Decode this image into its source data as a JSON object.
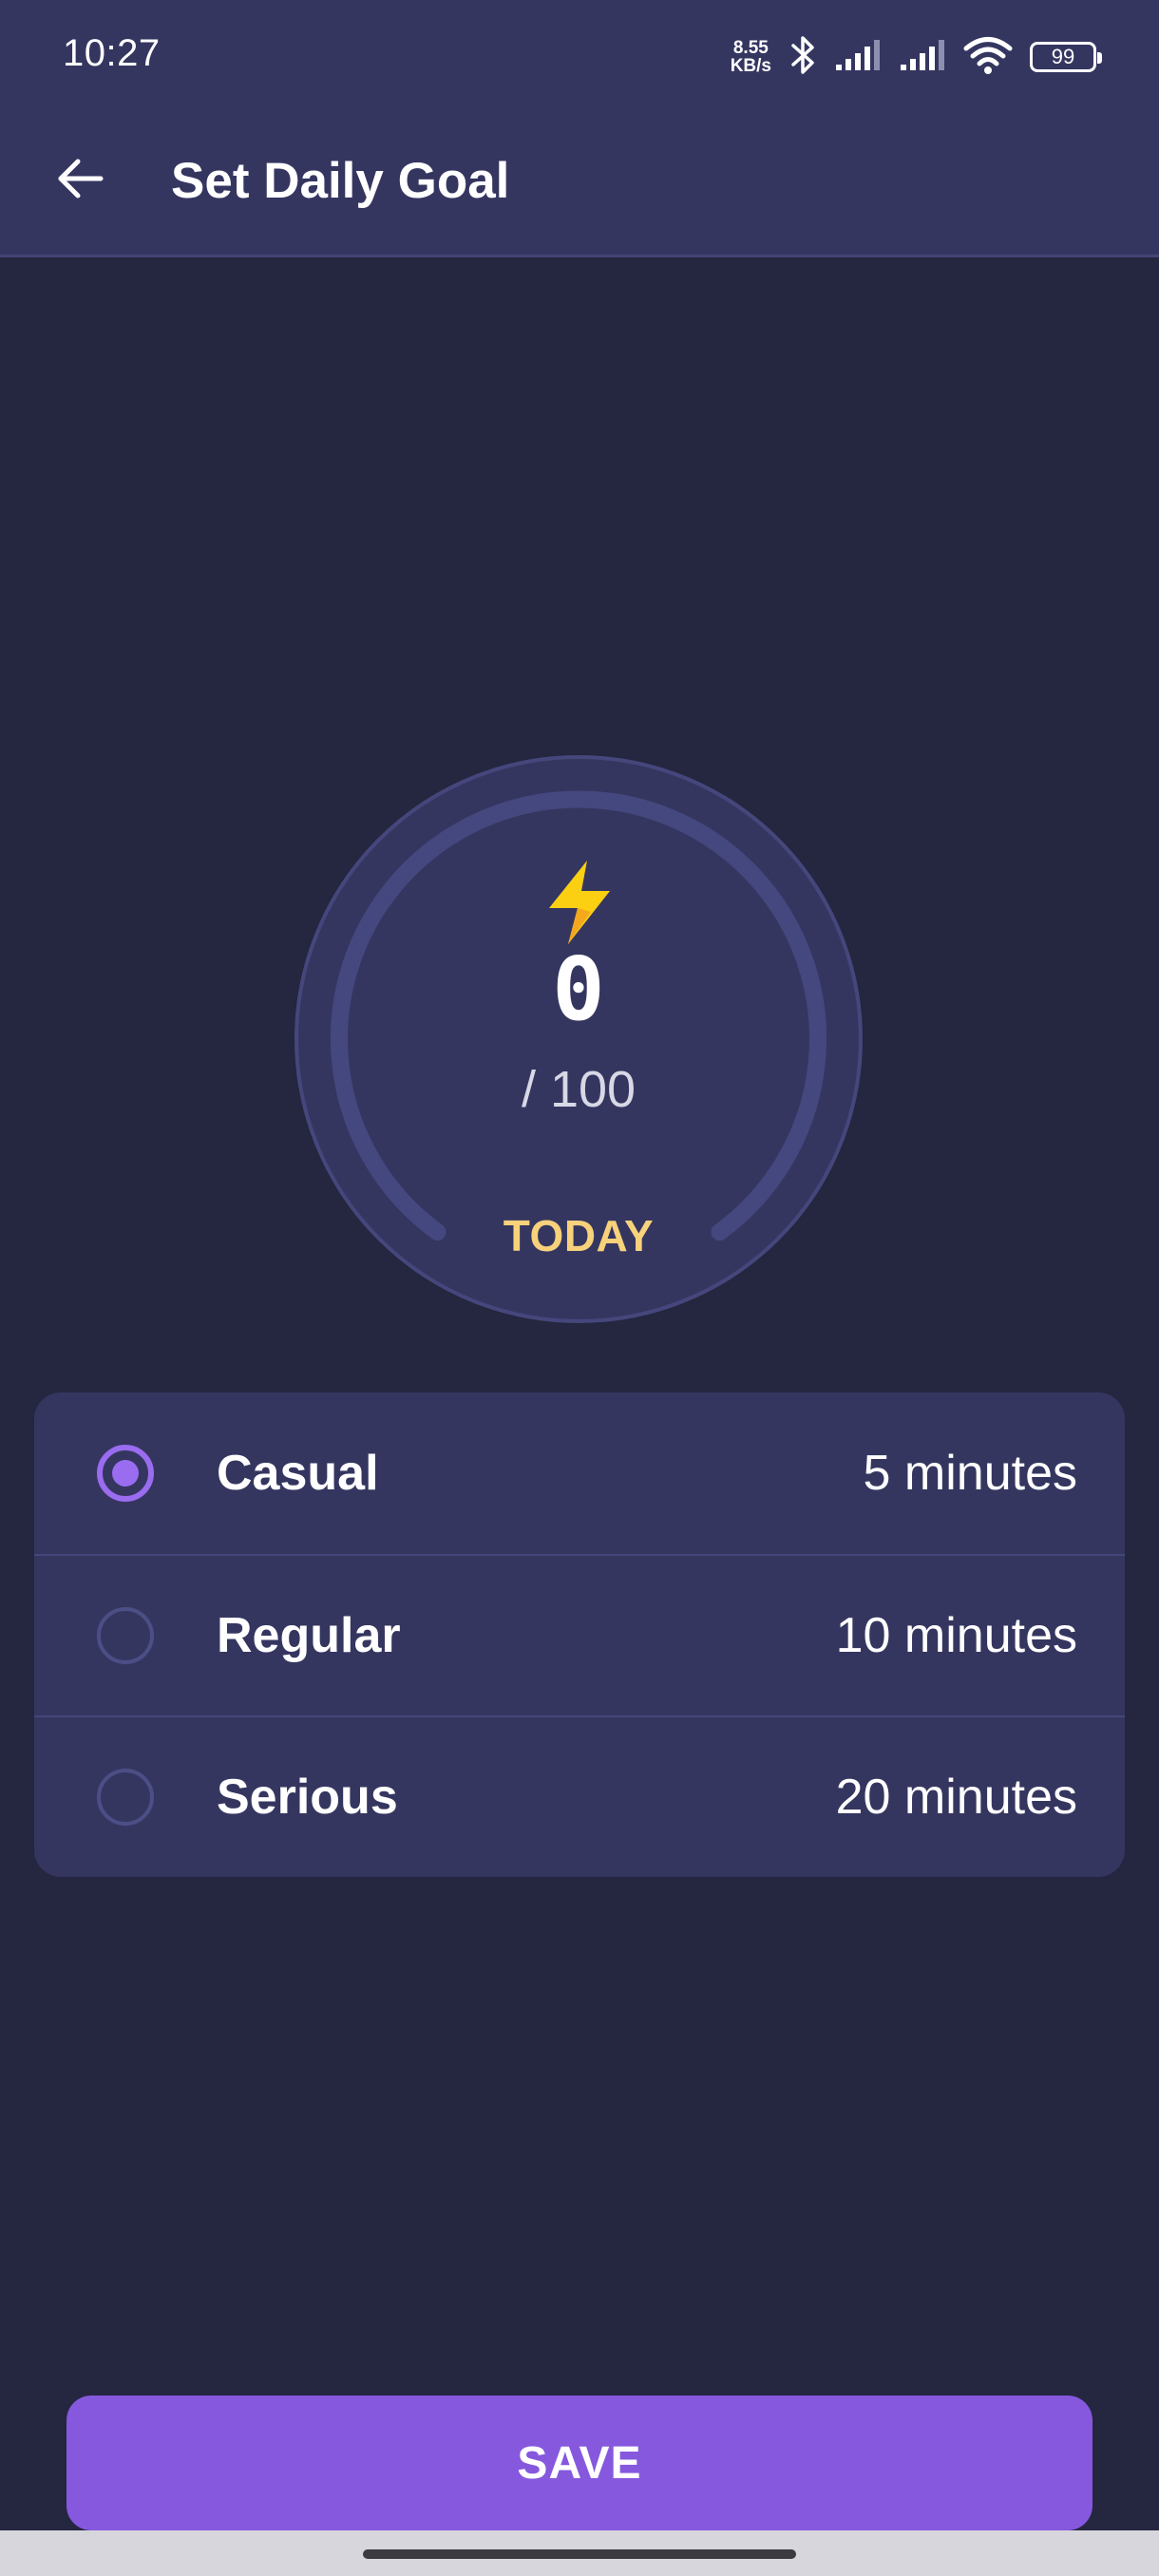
{
  "status_bar": {
    "time": "10:27",
    "net_speed_value": "8.55",
    "net_speed_unit": "KB/s",
    "battery": "99",
    "icons": [
      "bluetooth-icon",
      "signal-icon",
      "signal-icon",
      "wifi-icon",
      "battery-icon"
    ]
  },
  "app_bar": {
    "back_icon": "arrow-left-icon",
    "title": "Set Daily Goal"
  },
  "goal": {
    "icon": "lightning-bolt-icon",
    "value": "0",
    "total": "/ 100",
    "label": "TODAY",
    "progress_fraction": 0
  },
  "options": [
    {
      "label": "Casual",
      "duration": "5 minutes",
      "selected": true
    },
    {
      "label": "Regular",
      "duration": "10 minutes",
      "selected": false
    },
    {
      "label": "Serious",
      "duration": "20 minutes",
      "selected": false
    }
  ],
  "save_button": {
    "label": "SAVE"
  },
  "colors": {
    "background": "#25263f",
    "surface": "#353660",
    "accent": "#8658de",
    "radio_selected": "#9a6cf0",
    "today_label": "#f7d27b",
    "bolt": "#fbd013"
  }
}
